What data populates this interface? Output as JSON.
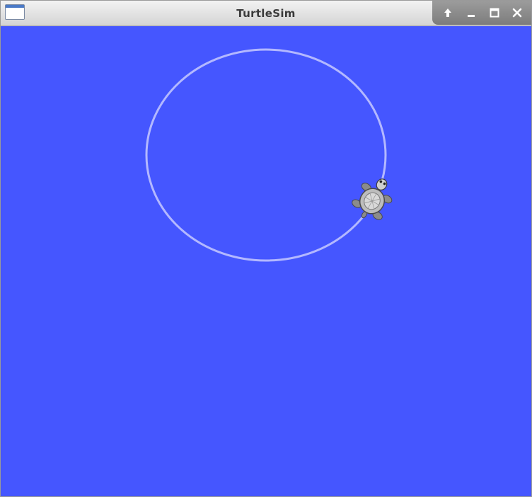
{
  "window": {
    "title": "TurtleSim",
    "background_color": "#4556ff",
    "pen_color": "#b3b8ff",
    "icons": [
      "app-window-icon",
      "shade-up-icon",
      "minimize-icon",
      "maximize-icon",
      "close-icon"
    ]
  }
}
